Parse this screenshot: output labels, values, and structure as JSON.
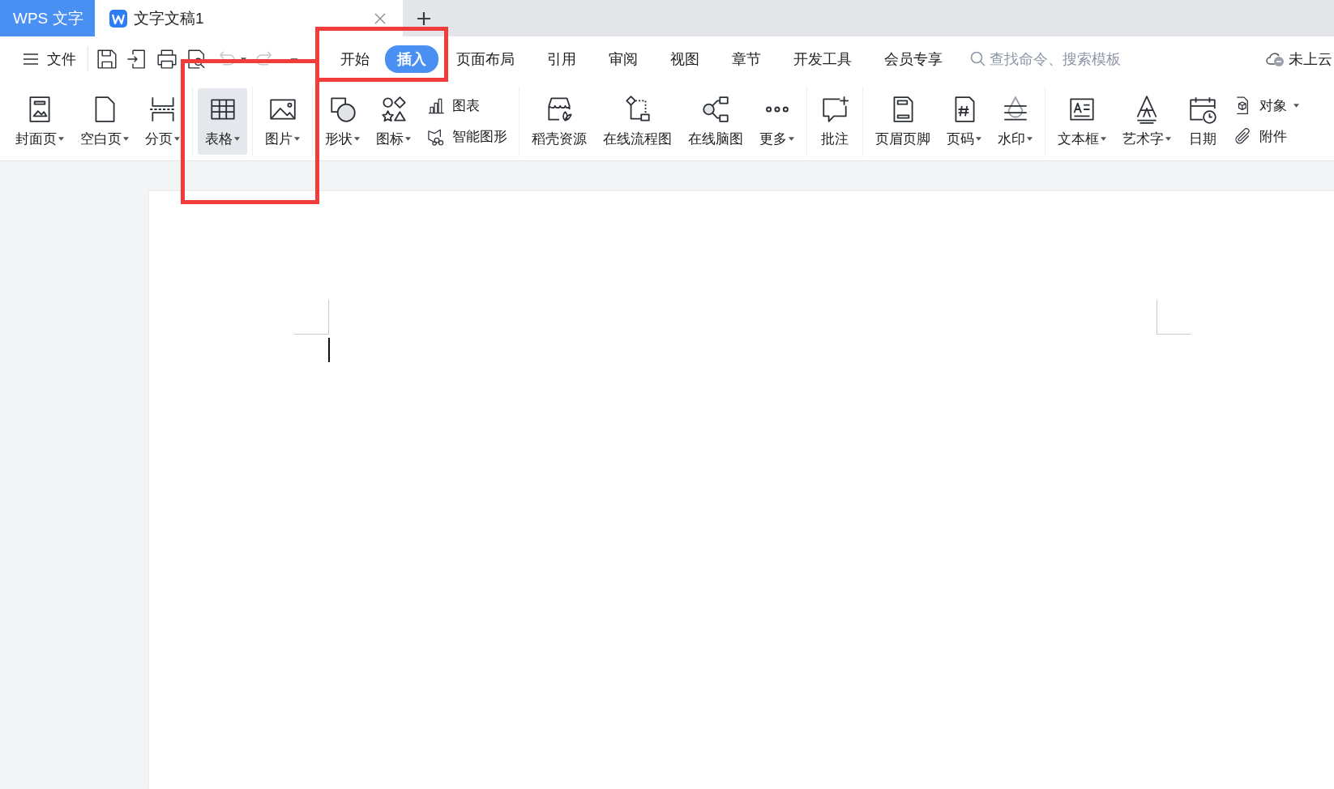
{
  "app_tab": {
    "label": "WPS 文字"
  },
  "doc_tabs": [
    {
      "label": "文字文稿1",
      "selected": true
    }
  ],
  "quick_toolbar": {
    "file_label": "文件",
    "tools": [
      {
        "kind": "save",
        "disabled": false
      },
      {
        "kind": "export",
        "disabled": false
      },
      {
        "kind": "print",
        "disabled": false
      },
      {
        "kind": "preview",
        "disabled": false
      },
      {
        "kind": "undo",
        "disabled": true
      },
      {
        "kind": "redo",
        "disabled": true
      },
      {
        "kind": "dash",
        "disabled": false
      }
    ]
  },
  "menu_tabs": [
    {
      "label": "开始",
      "selected": false
    },
    {
      "label": "插入",
      "selected": true
    },
    {
      "label": "页面布局",
      "selected": false
    },
    {
      "label": "引用",
      "selected": false
    },
    {
      "label": "审阅",
      "selected": false
    },
    {
      "label": "视图",
      "selected": false
    },
    {
      "label": "章节",
      "selected": false
    },
    {
      "label": "开发工具",
      "selected": false
    },
    {
      "label": "会员专享",
      "selected": false
    }
  ],
  "search": {
    "placeholder": "查找命令、搜索模板"
  },
  "cloud": {
    "label": "未上云"
  },
  "ribbon": {
    "groups": [
      {
        "items": [
          {
            "kind": "cover",
            "label": "封面页",
            "dropdown": true,
            "selected": false
          },
          {
            "kind": "blank",
            "label": "空白页",
            "dropdown": true,
            "selected": false
          },
          {
            "kind": "break",
            "label": "分页",
            "dropdown": true,
            "selected": false
          }
        ]
      },
      {
        "items": [
          {
            "kind": "table",
            "label": "表格",
            "dropdown": true,
            "selected": true
          }
        ]
      },
      {
        "items": [
          {
            "kind": "image",
            "label": "图片",
            "dropdown": true,
            "selected": false
          }
        ]
      },
      {
        "items": [
          {
            "kind": "shape",
            "label": "形状",
            "dropdown": true,
            "selected": false
          },
          {
            "kind": "icons",
            "label": "图标",
            "dropdown": true,
            "selected": false
          },
          {
            "kind": "stack",
            "items": [
              {
                "kind": "chart",
                "label": "图表",
                "dropdown": false,
                "selected": false
              },
              {
                "kind": "smart",
                "label": "智能图形",
                "dropdown": false,
                "selected": false
              }
            ]
          }
        ]
      },
      {
        "items": [
          {
            "kind": "store",
            "label": "稻壳资源",
            "dropdown": false,
            "selected": false
          },
          {
            "kind": "flow",
            "label": "在线流程图",
            "dropdown": false,
            "selected": false
          },
          {
            "kind": "mind",
            "label": "在线脑图",
            "dropdown": false,
            "selected": false
          },
          {
            "kind": "more",
            "label": "更多",
            "dropdown": true,
            "selected": false
          }
        ]
      },
      {
        "items": [
          {
            "kind": "comment",
            "label": "批注",
            "dropdown": false,
            "selected": false
          }
        ]
      },
      {
        "items": [
          {
            "kind": "header",
            "label": "页眉页脚",
            "dropdown": false,
            "selected": false
          },
          {
            "kind": "pagenum",
            "label": "页码",
            "dropdown": true,
            "selected": false
          },
          {
            "kind": "watermark",
            "label": "水印",
            "dropdown": true,
            "selected": false
          }
        ]
      },
      {
        "items": [
          {
            "kind": "textbox",
            "label": "文本框",
            "dropdown": true,
            "selected": false
          },
          {
            "kind": "art",
            "label": "艺术字",
            "dropdown": true,
            "selected": false
          },
          {
            "kind": "date",
            "label": "日期",
            "dropdown": false,
            "selected": false
          },
          {
            "kind": "stack",
            "items": [
              {
                "kind": "object",
                "label": "对象",
                "dropdown": true,
                "selected": false
              },
              {
                "kind": "attach",
                "label": "附件",
                "dropdown": false,
                "selected": false
              }
            ]
          }
        ]
      }
    ]
  },
  "annotations": [
    {
      "kind": "frame",
      "color": "#f23b3b"
    },
    {
      "kind": "frame",
      "color": "#f23b3b"
    }
  ]
}
